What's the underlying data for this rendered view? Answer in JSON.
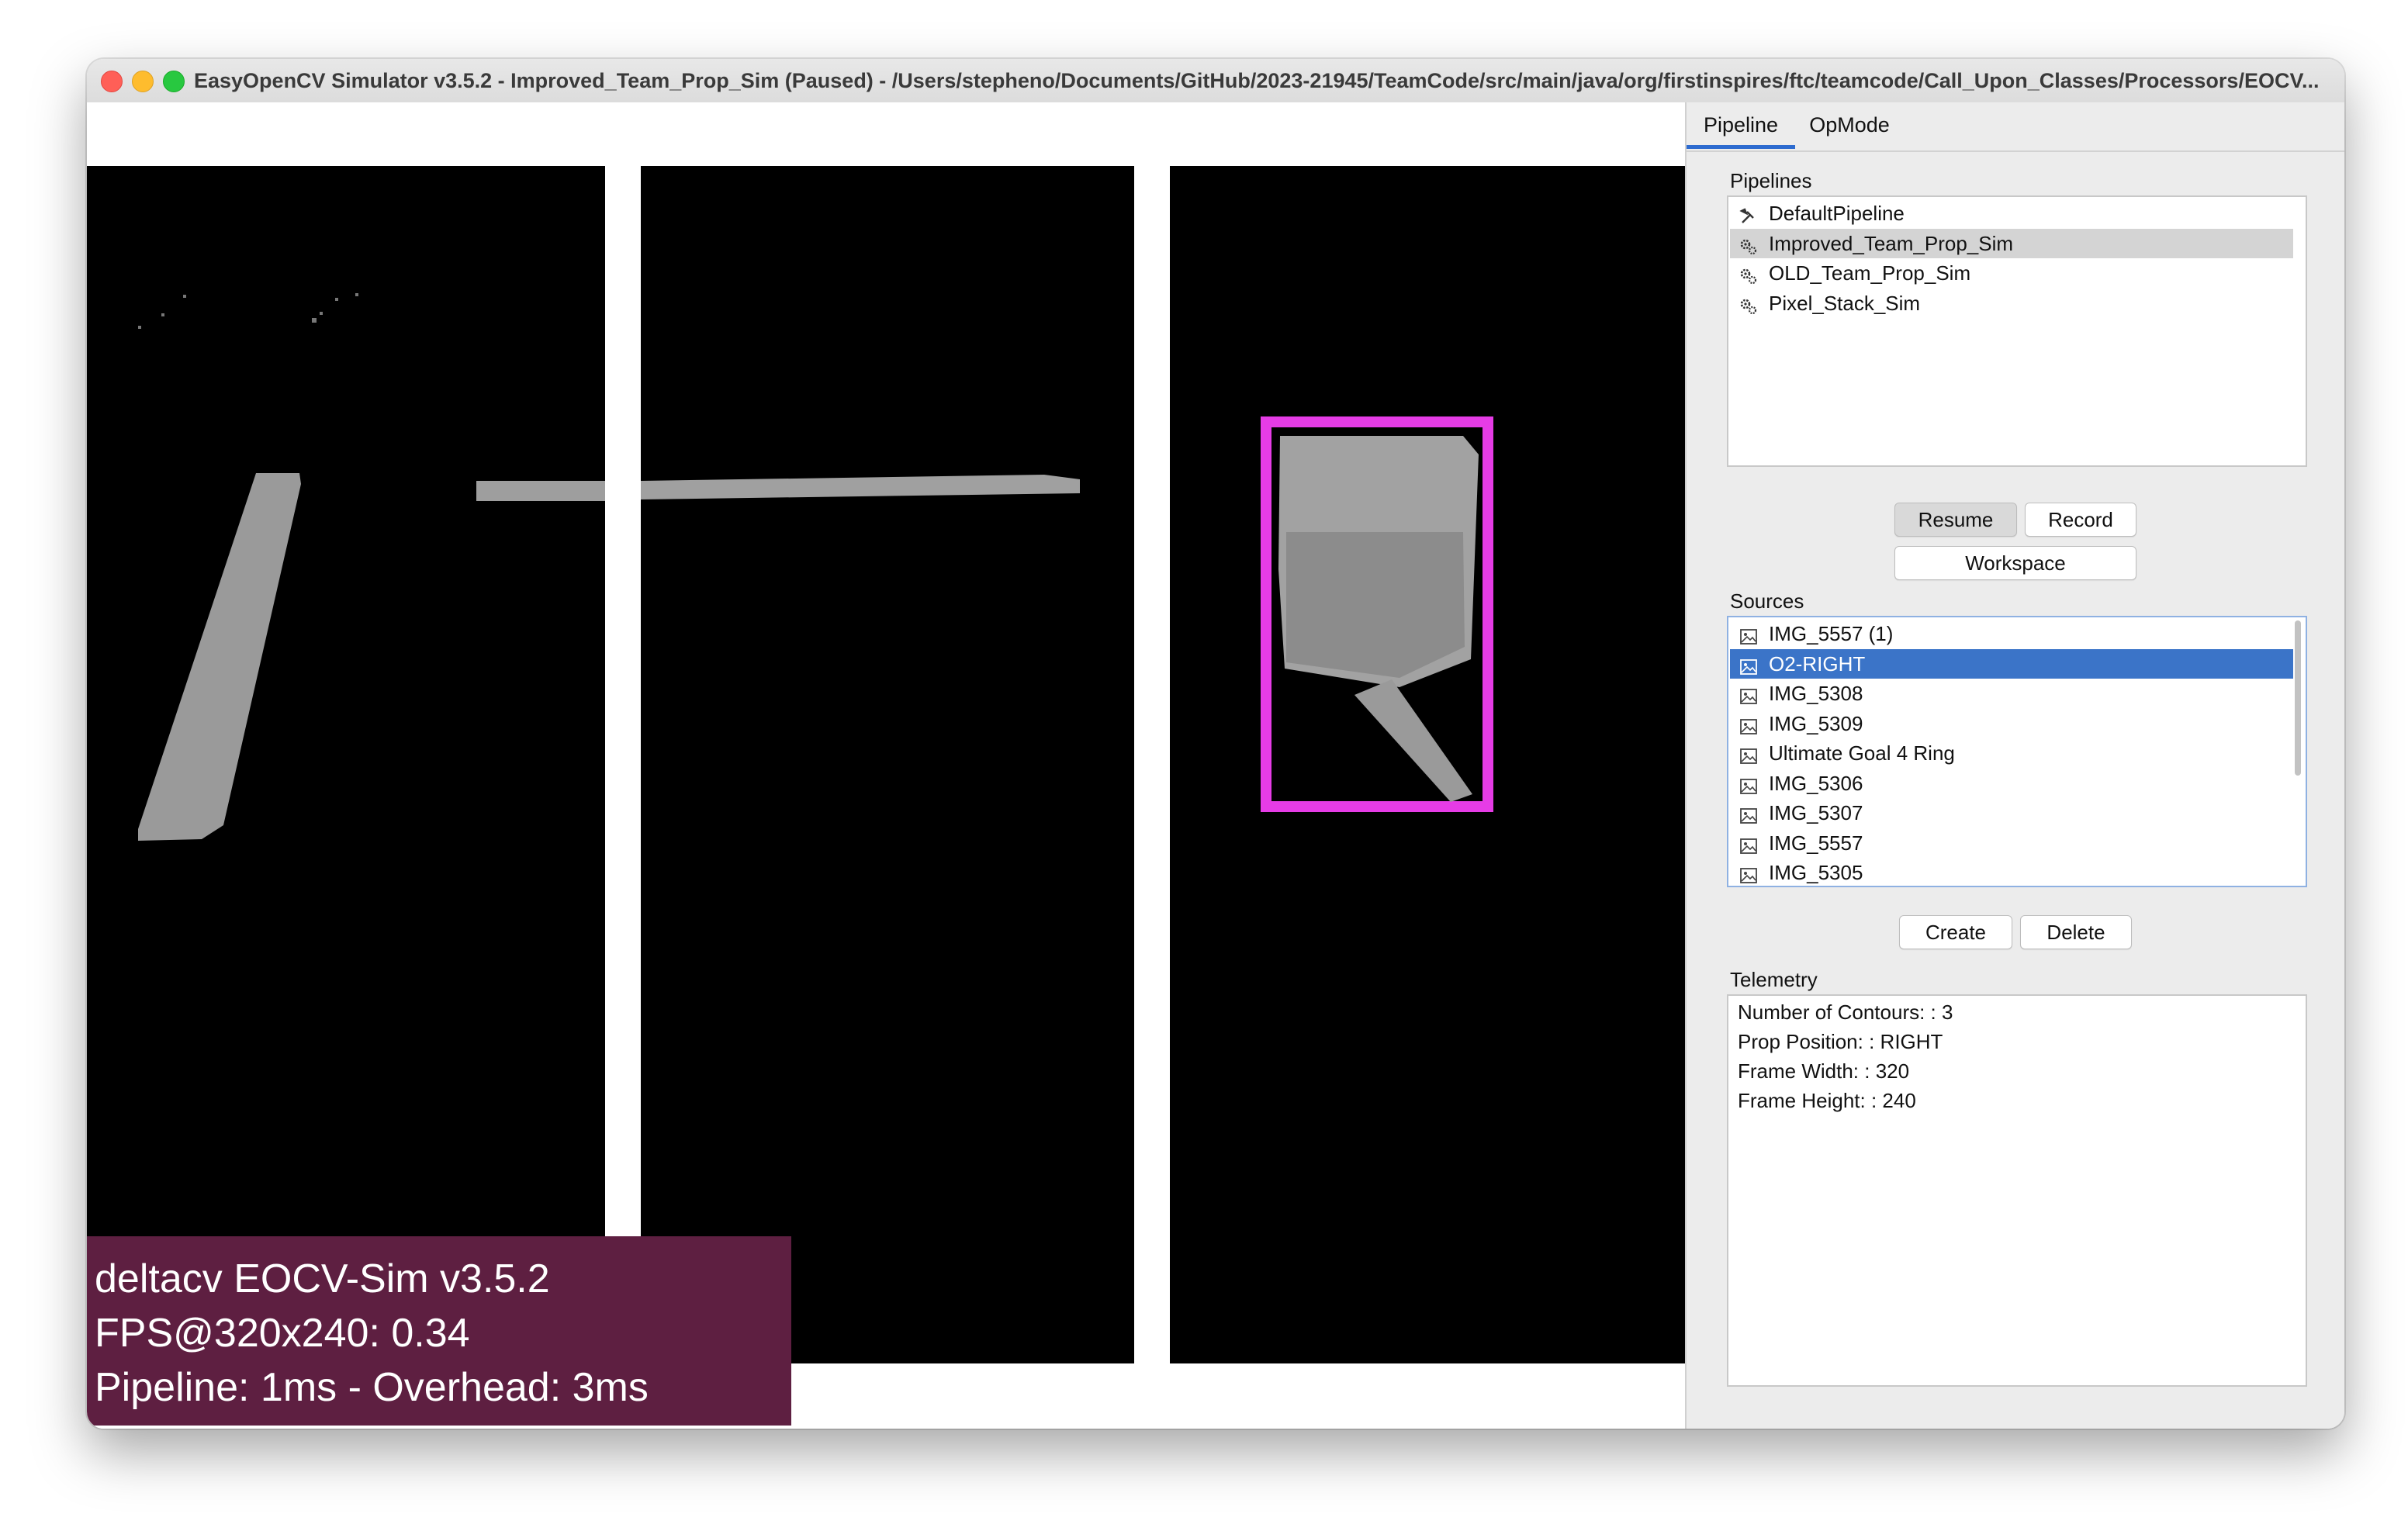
{
  "window": {
    "title": "EasyOpenCV Simulator v3.5.2 - Improved_Team_Prop_Sim (Paused) - /Users/stepheno/Documents/GitHub/2023-21945/TeamCode/src/main/java/org/firstinspires/ftc/teamcode/Call_Upon_Classes/Processors/EOCV..."
  },
  "overlay": {
    "line1": "deltacv EOCV-Sim v3.5.2",
    "line2": "FPS@320x240: 0.34",
    "line3": "Pipeline: 1ms - Overhead: 3ms"
  },
  "colors": {
    "overlay_bg": "#5e1f41",
    "detection_box": "#e63ce6",
    "selection_blue": "#3b74c8",
    "selection_gray": "#d4d4d4"
  },
  "tabs": [
    {
      "label": "Pipeline",
      "active": true
    },
    {
      "label": "OpMode",
      "active": false
    }
  ],
  "pipelines": {
    "label": "Pipelines",
    "items": [
      {
        "label": "DefaultPipeline",
        "icon": "tools-icon",
        "selected": false
      },
      {
        "label": "Improved_Team_Prop_Sim",
        "icon": "gears-icon",
        "selected": true
      },
      {
        "label": "OLD_Team_Prop_Sim",
        "icon": "gears-icon",
        "selected": false
      },
      {
        "label": "Pixel_Stack_Sim",
        "icon": "gears-icon",
        "selected": false
      }
    ],
    "resume_label": "Resume",
    "record_label": "Record",
    "workspace_label": "Workspace"
  },
  "sources": {
    "label": "Sources",
    "items": [
      {
        "label": "IMG_5557 (1)",
        "icon": "image-icon",
        "selected": false
      },
      {
        "label": "O2-RIGHT",
        "icon": "image-icon",
        "selected": true
      },
      {
        "label": "IMG_5308",
        "icon": "image-icon",
        "selected": false
      },
      {
        "label": "IMG_5309",
        "icon": "image-icon",
        "selected": false
      },
      {
        "label": "Ultimate Goal 4 Ring",
        "icon": "image-icon",
        "selected": false
      },
      {
        "label": "IMG_5306",
        "icon": "image-icon",
        "selected": false
      },
      {
        "label": "IMG_5307",
        "icon": "image-icon",
        "selected": false
      },
      {
        "label": "IMG_5557",
        "icon": "image-icon",
        "selected": false
      },
      {
        "label": "IMG_5305",
        "icon": "image-icon",
        "selected": false
      }
    ],
    "create_label": "Create",
    "delete_label": "Delete"
  },
  "telemetry": {
    "label": "Telemetry",
    "lines": [
      "Number of Contours:  : 3",
      "Prop Position:  : RIGHT",
      "Frame Width:  : 320",
      "Frame Height:  : 240"
    ]
  }
}
